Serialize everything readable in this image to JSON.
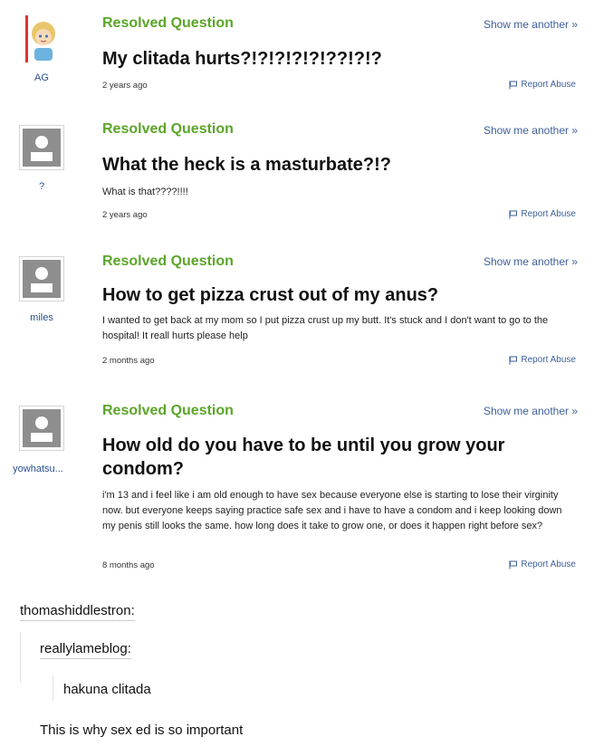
{
  "questions": [
    {
      "status": "Resolved Question",
      "show_another": "Show me another »",
      "username": "AG",
      "title": "My clitada hurts?!?!?!?!?!??!?!?",
      "details": "",
      "time": "2 years ago",
      "report": "Report Abuse",
      "avatar_icon": "cartoon-girl-avatar-icon"
    },
    {
      "status": "Resolved Question",
      "show_another": "Show me another »",
      "username": "?",
      "title": "What the heck is a masturbate?!?",
      "details": "What is that????!!!!",
      "time": "2 years ago",
      "report": "Report Abuse",
      "avatar_icon": "default-user-avatar-icon"
    },
    {
      "status": "Resolved Question",
      "show_another": "Show me another »",
      "username": "miles",
      "title": "How to get pizza crust out of my anus?",
      "details": "I wanted to get back at my mom so I put pizza crust up my butt. It's stuck and I don't want to go to the hospital! It reall hurts please help",
      "time": "2 months ago",
      "report": "Report Abuse",
      "avatar_icon": "default-user-avatar-icon"
    },
    {
      "status": "Resolved Question",
      "show_another": "Show me another »",
      "username": "yowhatsu...",
      "title": "How old do you have to be until you grow your condom?",
      "details": "i'm 13 and i feel like i am old enough to have sex because everyone else is starting to lose their virginity now. but everyone keeps saying practice safe sex and i have to have a condom and i keep looking down my penis still looks the same. how long does it take to grow one, or does it happen right before sex?",
      "time": "8 months ago",
      "report": "Report Abuse",
      "avatar_icon": "default-user-avatar-icon"
    }
  ],
  "tumblr": {
    "user1": "thomashiddlestron:",
    "user2": "reallylameblog:",
    "quote": "hakuna clitada",
    "comment": "This is why sex ed is so important"
  },
  "colors": {
    "status_green": "#5ba628",
    "link_blue": "#3e5f9a"
  }
}
